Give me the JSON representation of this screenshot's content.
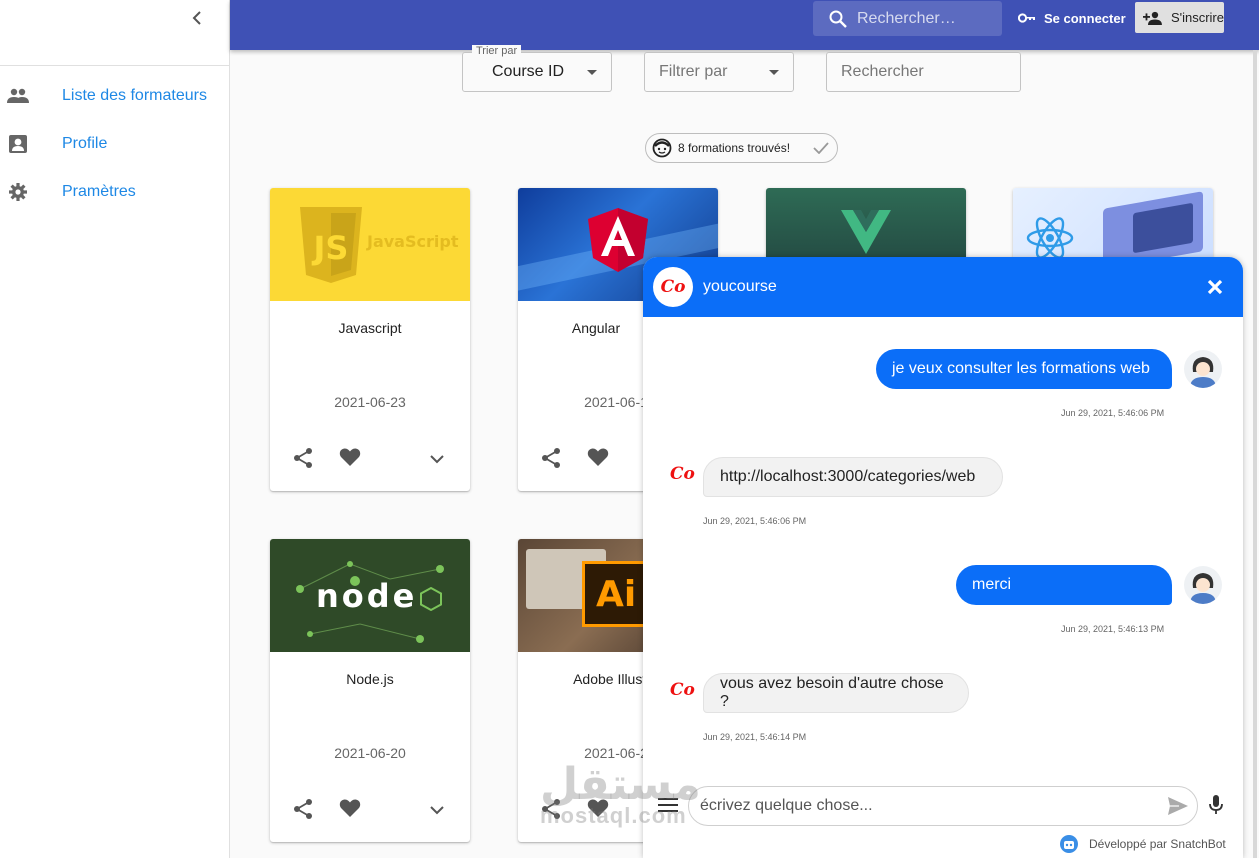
{
  "sidebar": {
    "items": [
      {
        "label": "Liste des formateurs",
        "icon": "people-icon"
      },
      {
        "label": "Profile",
        "icon": "account-box-icon"
      },
      {
        "label": "Pramètres",
        "icon": "gear-icon"
      }
    ]
  },
  "topbar": {
    "search_placeholder": "Rechercher…",
    "login_label": "Se connecter",
    "signup_label": "S'inscrire"
  },
  "filters": {
    "sort_legend": "Trier par",
    "sort_value": "Course ID",
    "filter_placeholder": "Filtrer par",
    "search_placeholder": "Rechercher"
  },
  "results": {
    "label": "8 formations trouvés!"
  },
  "courses": [
    {
      "title": "Javascript",
      "date": "2021-06-23",
      "logo_text": "JavaScript"
    },
    {
      "title": "Angular",
      "date": "2021-06-1"
    },
    {
      "title": "",
      "date": ""
    },
    {
      "title": "",
      "date": ""
    },
    {
      "title": "Node.js",
      "date": "2021-06-20",
      "logo_text": "node"
    },
    {
      "title": "Adobe Illustr",
      "date": "2021-06-2",
      "logo_text": "Ai"
    }
  ],
  "chat": {
    "bot_name": "youcourse",
    "logo_text": "Co",
    "messages": [
      {
        "from": "user",
        "text": "je veux consulter les formations web",
        "time": "Jun 29, 2021, 5:46:06 PM"
      },
      {
        "from": "bot",
        "text": "http://localhost:3000/categories/web",
        "time": "Jun 29, 2021, 5:46:06 PM"
      },
      {
        "from": "user",
        "text": "merci",
        "time": "Jun 29, 2021, 5:46:13 PM"
      },
      {
        "from": "bot",
        "text": "vous avez besoin d'autre chose ?",
        "time": "Jun 29, 2021, 5:46:14 PM"
      }
    ],
    "input_placeholder": "écrivez quelque chose...",
    "powered_by": "Développé par SnatchBot"
  },
  "watermark": {
    "arabic": "مستقل",
    "latin": "mostaql.com"
  },
  "colors": {
    "appbar": "#3f51b5",
    "chat_header": "#0b6ef8",
    "link": "#1e88e5"
  }
}
